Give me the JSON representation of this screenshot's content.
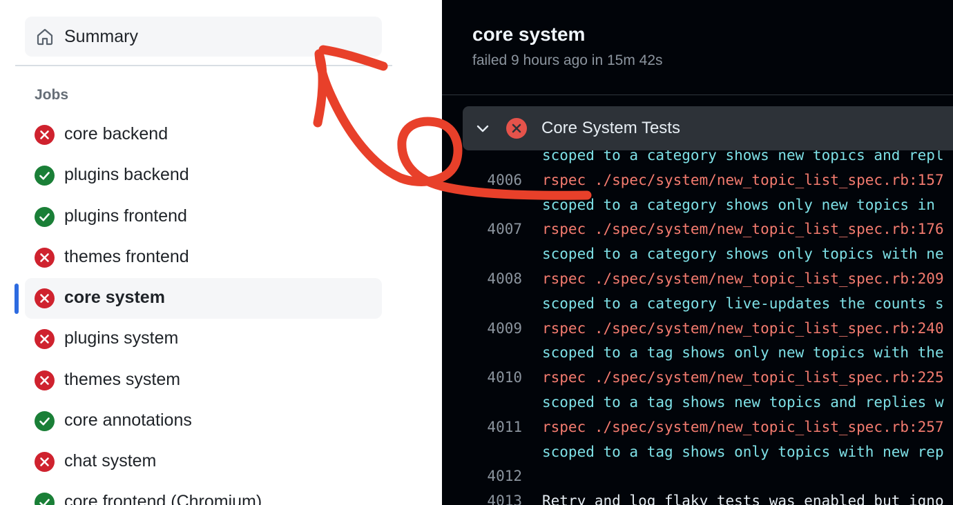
{
  "sidebar": {
    "summary_label": "Summary",
    "jobs_heading": "Jobs",
    "jobs": [
      {
        "name": "core backend",
        "status": "failed"
      },
      {
        "name": "plugins backend",
        "status": "success"
      },
      {
        "name": "plugins frontend",
        "status": "success"
      },
      {
        "name": "themes frontend",
        "status": "failed"
      },
      {
        "name": "core system",
        "status": "failed",
        "active": true
      },
      {
        "name": "plugins system",
        "status": "failed"
      },
      {
        "name": "themes system",
        "status": "failed"
      },
      {
        "name": "core annotations",
        "status": "success"
      },
      {
        "name": "chat system",
        "status": "failed"
      },
      {
        "name": "core frontend (Chromium)",
        "status": "success"
      }
    ]
  },
  "job_detail": {
    "title": "core system",
    "subtitle": "failed 9 hours ago in 15m 42s",
    "step": {
      "name": "Core System Tests",
      "status": "failed",
      "expanded": true
    },
    "log_lines": [
      {
        "num": "",
        "text": "scoped to a category shows new topics and repl",
        "color": "cyan"
      },
      {
        "num": "4006",
        "text": "rspec ./spec/system/new_topic_list_spec.rb:157",
        "color": "red"
      },
      {
        "num": "",
        "text": "scoped to a category shows only new topics in",
        "color": "cyan"
      },
      {
        "num": "4007",
        "text": "rspec ./spec/system/new_topic_list_spec.rb:176",
        "color": "red"
      },
      {
        "num": "",
        "text": "scoped to a category shows only topics with ne",
        "color": "cyan"
      },
      {
        "num": "4008",
        "text": "rspec ./spec/system/new_topic_list_spec.rb:209",
        "color": "red"
      },
      {
        "num": "",
        "text": "scoped to a category live-updates the counts s",
        "color": "cyan"
      },
      {
        "num": "4009",
        "text": "rspec ./spec/system/new_topic_list_spec.rb:240",
        "color": "red"
      },
      {
        "num": "",
        "text": "scoped to a tag shows only new topics with the",
        "color": "cyan"
      },
      {
        "num": "4010",
        "text": "rspec ./spec/system/new_topic_list_spec.rb:225",
        "color": "red"
      },
      {
        "num": "",
        "text": "scoped to a tag shows new topics and replies w",
        "color": "cyan"
      },
      {
        "num": "4011",
        "text": "rspec ./spec/system/new_topic_list_spec.rb:257",
        "color": "red"
      },
      {
        "num": "",
        "text": "scoped to a tag shows only topics with new rep",
        "color": "cyan"
      },
      {
        "num": "4012",
        "text": "",
        "color": "white"
      },
      {
        "num": "4013",
        "text": "Retry and log flaky tests was enabled but igno",
        "color": "white"
      }
    ]
  },
  "colors": {
    "failed": "#cf222e",
    "success": "#1a7f37",
    "active_indicator": "#2d6be0",
    "annotation": "#e8402a"
  },
  "icons": {
    "summary": "home-icon",
    "failed": "x-circle-icon",
    "success": "check-circle-icon",
    "collapse": "chevron-down-icon"
  }
}
